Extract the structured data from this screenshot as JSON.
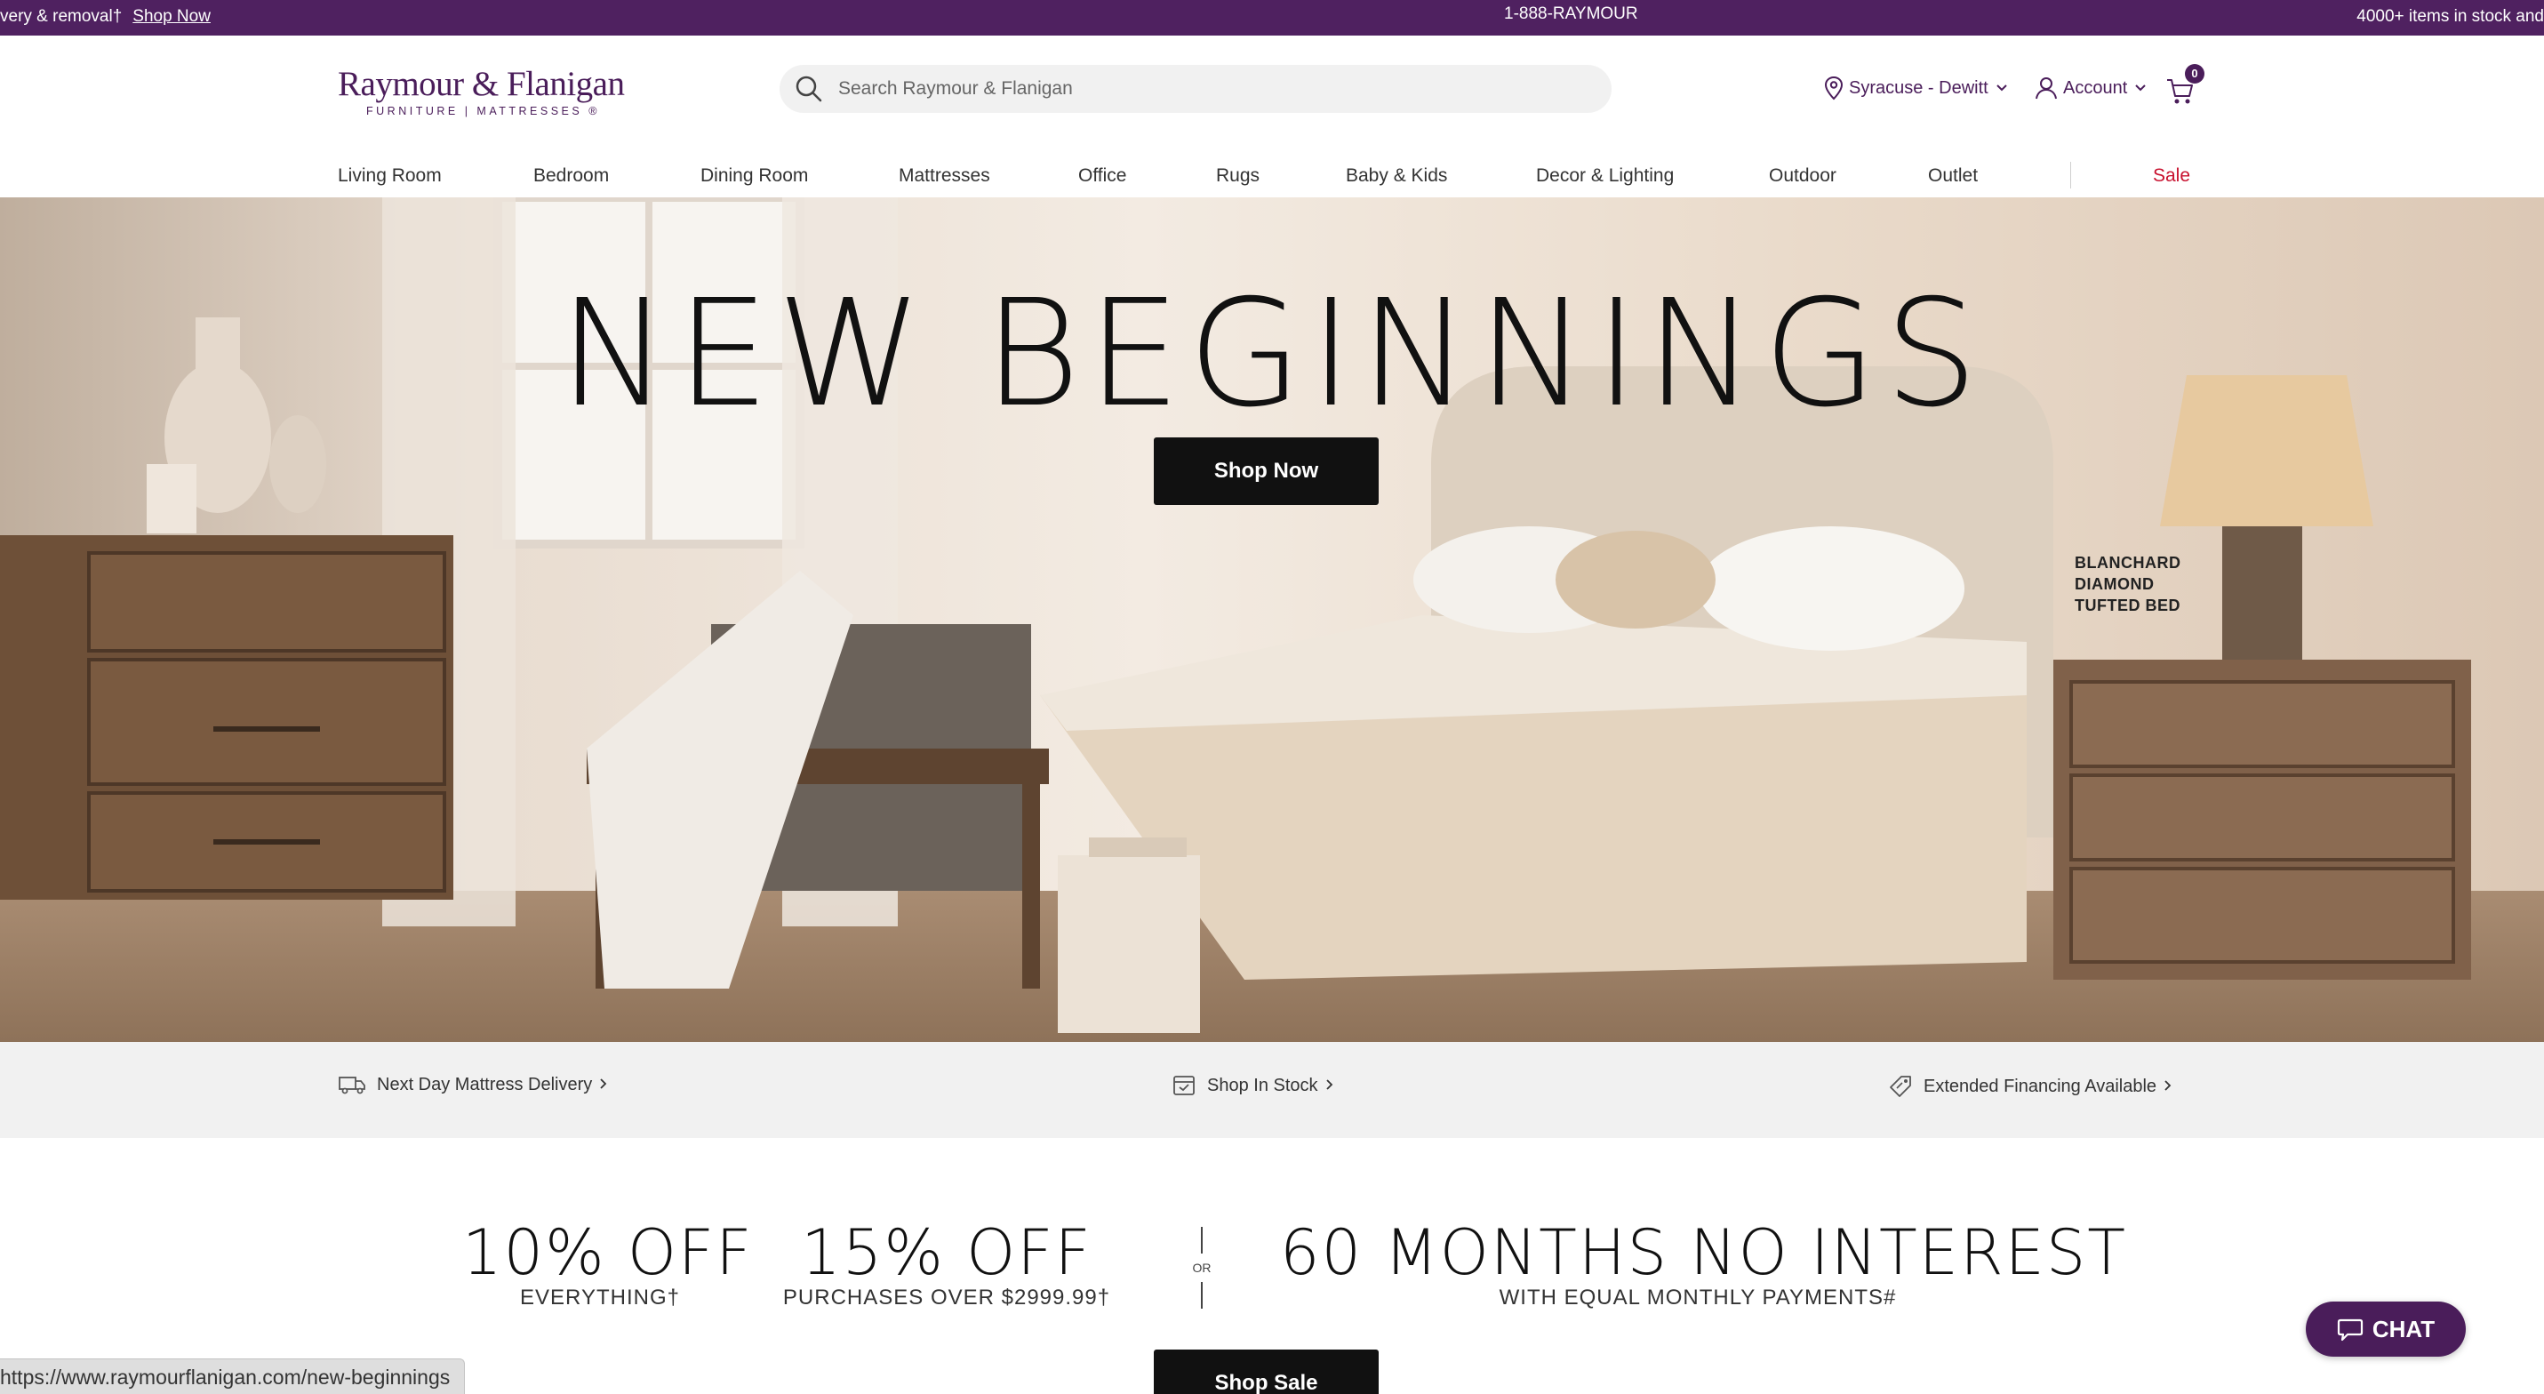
{
  "promo_bar": {
    "left_text": "very & removal†",
    "left_link": "Shop Now",
    "phone": "1-888-RAYMOUR",
    "right_text": "4000+ items in stock and"
  },
  "header": {
    "logo_main": "Raymour & Flanigan",
    "logo_sub": "FURNITURE | MATTRESSES ®",
    "search_placeholder": "Search Raymour & Flanigan",
    "location": "Syracuse - Dewitt",
    "account": "Account",
    "cart_count": "0"
  },
  "nav": {
    "items": [
      {
        "label": "Living Room"
      },
      {
        "label": "Bedroom"
      },
      {
        "label": "Dining Room"
      },
      {
        "label": "Mattresses"
      },
      {
        "label": "Office"
      },
      {
        "label": "Rugs"
      },
      {
        "label": "Baby & Kids"
      },
      {
        "label": "Decor & Lighting"
      },
      {
        "label": "Outdoor"
      },
      {
        "label": "Outlet"
      }
    ],
    "sale": "Sale"
  },
  "hero": {
    "title": "NEW BEGINNINGS",
    "button": "Shop Now",
    "caption_line1": "BLANCHARD",
    "caption_line2": "DIAMOND",
    "caption_line3": "TUFTED BED"
  },
  "features": [
    {
      "label": "Next Day Mattress Delivery",
      "icon": "truck-icon"
    },
    {
      "label": "Shop In Stock",
      "icon": "box-icon"
    },
    {
      "label": "Extended Financing Available",
      "icon": "tag-icon"
    }
  ],
  "sale": {
    "offer1_big": "10% OFF",
    "offer1_small": "EVERYTHING†",
    "offer2_big": "15% OFF",
    "offer2_small": "PURCHASES OVER $2999.99†",
    "or": "OR",
    "offer3_big": "60 MONTHS NO INTEREST",
    "offer3_small": "WITH EQUAL MONTHLY PAYMENTS#",
    "button": "Shop Sale"
  },
  "chat": {
    "label": "CHAT"
  },
  "status_url": "https://www.raymourflanigan.com/new-beginnings",
  "colors": {
    "brand_purple": "#4f2160",
    "sale_red": "#c8102e",
    "button_black": "#111111"
  }
}
